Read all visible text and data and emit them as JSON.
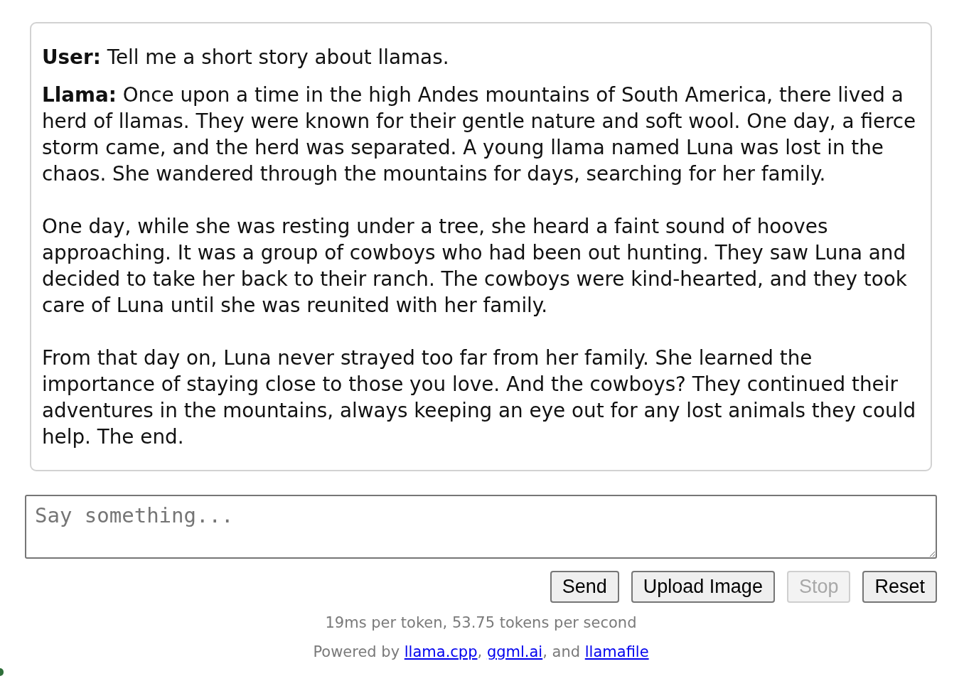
{
  "messages": [
    {
      "text": "**User:** Tell me a short story about llamas."
    },
    {
      "text": "**Llama:** Once upon a time in the high Andes mountains of South America, there lived a herd of llamas. They were known for their gentle nature and soft wool. One day, a fierce storm came, and the herd was separated. A young llama named Luna was lost in the chaos. She wandered through the mountains for days, searching for her family.\n\nOne day, while she was resting under a tree, she heard a faint sound of hooves approaching. It was a group of cowboys who had been out hunting. They saw Luna and decided to take her back to their ranch. The cowboys were kind-hearted, and they took care of Luna until she was reunited with her family.\n\nFrom that day on, Luna never strayed too far from her family. She learned the importance of staying close to those you love. And the cowboys? They continued their adventures in the mountains, always keeping an eye out for any lost animals they could help. The end."
    }
  ],
  "input": {
    "placeholder": "Say something..."
  },
  "buttons": [
    {
      "label": "Send",
      "disabled": false
    },
    {
      "label": "Upload Image",
      "disabled": false
    },
    {
      "label": "Stop",
      "disabled": true
    },
    {
      "label": "Reset",
      "disabled": false
    }
  ],
  "stats": "19ms per token, 53.75 tokens per second",
  "footer": [
    {
      "kind": "text",
      "text": "Powered by "
    },
    {
      "kind": "link",
      "text": "llama.cpp"
    },
    {
      "kind": "text",
      "text": ", "
    },
    {
      "kind": "link",
      "text": "ggml.ai"
    },
    {
      "kind": "text",
      "text": ", and "
    },
    {
      "kind": "link",
      "text": "llamafile"
    }
  ]
}
